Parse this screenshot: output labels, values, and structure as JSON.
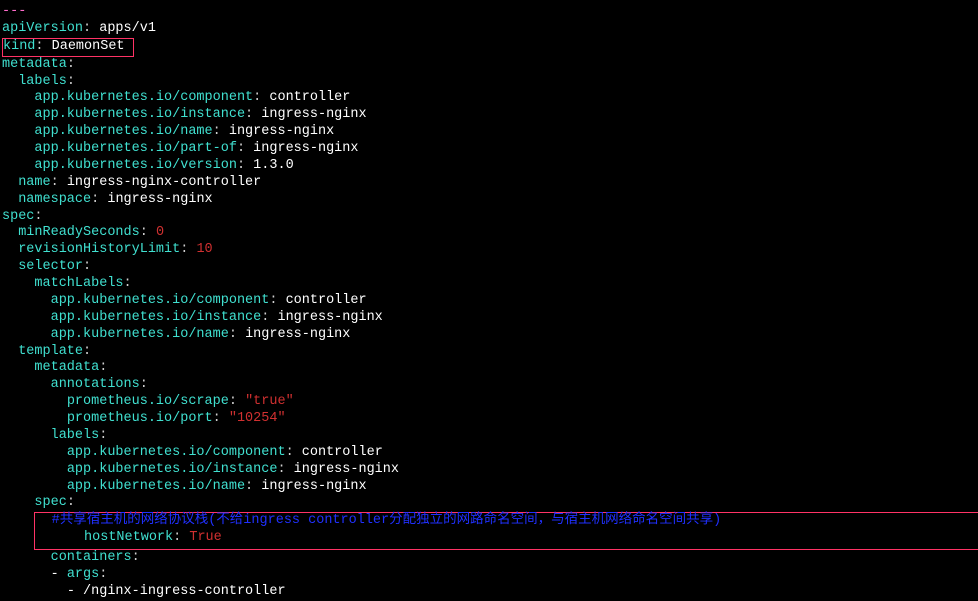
{
  "divider": "---",
  "l1": {
    "k": "apiVersion",
    "v": "apps/v1"
  },
  "l2": {
    "k": "kind",
    "v": "DaemonSet"
  },
  "l3": {
    "k": "metadata"
  },
  "l4": {
    "k": "labels"
  },
  "l5": {
    "k": "app.kubernetes.io/component",
    "v": "controller"
  },
  "l6": {
    "k": "app.kubernetes.io/instance",
    "v": "ingress-nginx"
  },
  "l7": {
    "k": "app.kubernetes.io/name",
    "v": "ingress-nginx"
  },
  "l8": {
    "k": "app.kubernetes.io/part-of",
    "v": "ingress-nginx"
  },
  "l9": {
    "k": "app.kubernetes.io/version",
    "v": "1.3.0"
  },
  "l10": {
    "k": "name",
    "v": "ingress-nginx-controller"
  },
  "l11": {
    "k": "namespace",
    "v": "ingress-nginx"
  },
  "l12": {
    "k": "spec"
  },
  "l13": {
    "k": "minReadySeconds",
    "v": "0"
  },
  "l14": {
    "k": "revisionHistoryLimit",
    "v": "10"
  },
  "l15": {
    "k": "selector"
  },
  "l16": {
    "k": "matchLabels"
  },
  "l17": {
    "k": "app.kubernetes.io/component",
    "v": "controller"
  },
  "l18": {
    "k": "app.kubernetes.io/instance",
    "v": "ingress-nginx"
  },
  "l19": {
    "k": "app.kubernetes.io/name",
    "v": "ingress-nginx"
  },
  "l20": {
    "k": "template"
  },
  "l21": {
    "k": "metadata"
  },
  "l22": {
    "k": "annotations"
  },
  "l23": {
    "k": "prometheus.io/scrape",
    "v": "\"true\""
  },
  "l24": {
    "k": "prometheus.io/port",
    "v": "\"10254\""
  },
  "l25": {
    "k": "labels"
  },
  "l26": {
    "k": "app.kubernetes.io/component",
    "v": "controller"
  },
  "l27": {
    "k": "app.kubernetes.io/instance",
    "v": "ingress-nginx"
  },
  "l28": {
    "k": "app.kubernetes.io/name",
    "v": "ingress-nginx"
  },
  "l29": {
    "k": "spec"
  },
  "l30": {
    "comment": "#共享宿主机的网络协议栈(不给ingress controller分配独立的网路命名空间，与宿主机网络命名空间共享)"
  },
  "l31": {
    "k": "hostNetwork",
    "v": "True"
  },
  "l32": {
    "k": "containers"
  },
  "l33": {
    "k": "args"
  },
  "l34": {
    "v": "/nginx-ingress-controller"
  }
}
